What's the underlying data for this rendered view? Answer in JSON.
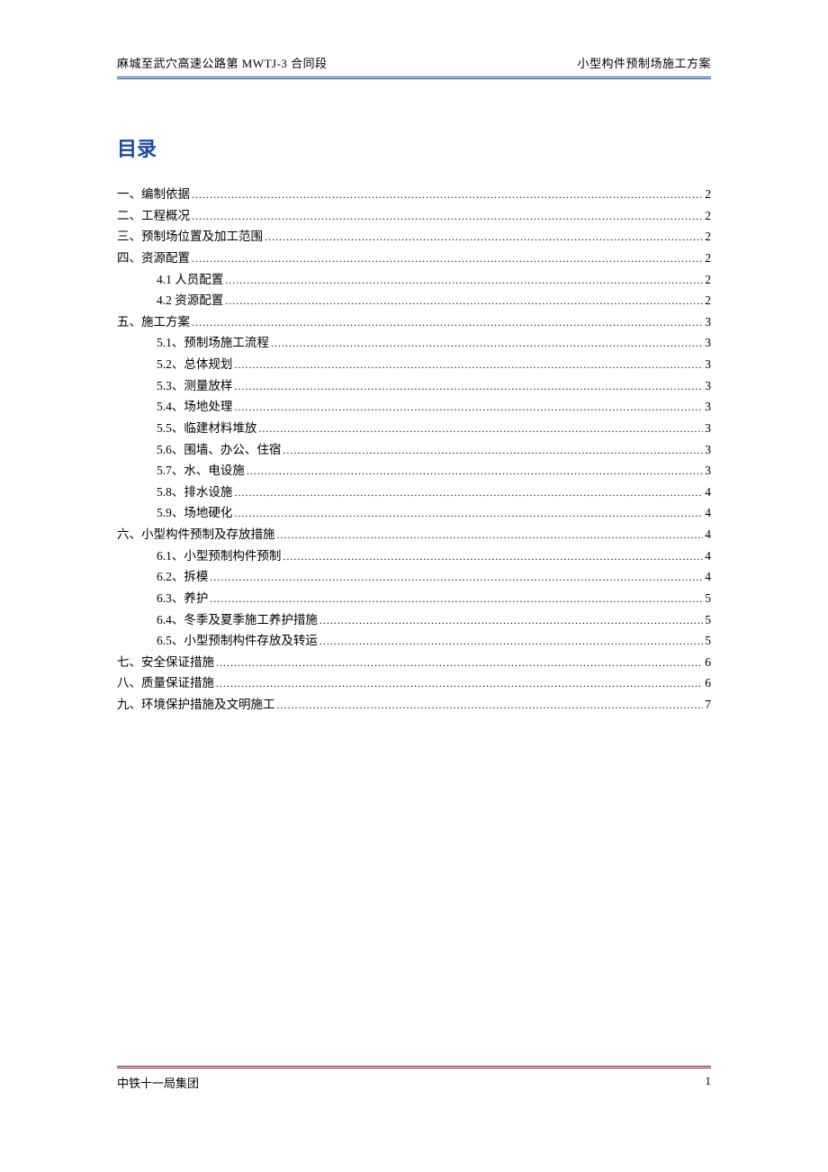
{
  "header": {
    "left": "麻城至武穴高速公路第 MWTJ-3 合同段",
    "right": "小型构件预制场施工方案"
  },
  "toc": {
    "title": "目录",
    "items": [
      {
        "level": 0,
        "label": "一、编制依据",
        "page": "2"
      },
      {
        "level": 0,
        "label": "二、工程概况",
        "page": "2"
      },
      {
        "level": 0,
        "label": "三、预制场位置及加工范围",
        "page": "2"
      },
      {
        "level": 0,
        "label": "四、资源配置",
        "page": "2"
      },
      {
        "level": 1,
        "label": "4.1 人员配置",
        "page": "2"
      },
      {
        "level": 1,
        "label": "4.2 资源配置",
        "page": "2"
      },
      {
        "level": 0,
        "label": "五、施工方案",
        "page": "3"
      },
      {
        "level": 1,
        "label": "5.1、预制场施工流程",
        "page": "3"
      },
      {
        "level": 1,
        "label": "5.2、总体规划",
        "page": "3"
      },
      {
        "level": 1,
        "label": "5.3、测量放样",
        "page": "3"
      },
      {
        "level": 1,
        "label": "5.4、场地处理",
        "page": "3"
      },
      {
        "level": 1,
        "label": "5.5、临建材料堆放",
        "page": "3"
      },
      {
        "level": 1,
        "label": "5.6、围墙、办公、住宿",
        "page": "3"
      },
      {
        "level": 1,
        "label": "5.7、水、电设施",
        "page": "3"
      },
      {
        "level": 1,
        "label": "5.8、排水设施",
        "page": "4"
      },
      {
        "level": 1,
        "label": "5.9、场地硬化",
        "page": "4"
      },
      {
        "level": 0,
        "label": "六、小型构件预制及存放措施",
        "page": "4"
      },
      {
        "level": 1,
        "label": "6.1、小型预制构件预制",
        "page": "4"
      },
      {
        "level": 1,
        "label": "6.2、拆模",
        "page": "4"
      },
      {
        "level": 1,
        "label": "6.3、养护",
        "page": "5"
      },
      {
        "level": 1,
        "label": "6.4、冬季及夏季施工养护措施",
        "page": "5"
      },
      {
        "level": 1,
        "label": "6.5、小型预制构件存放及转运",
        "page": "5"
      },
      {
        "level": 0,
        "label": "七、安全保证措施",
        "page": "6"
      },
      {
        "level": 0,
        "label": "八、质量保证措施",
        "page": "6"
      },
      {
        "level": 0,
        "label": "九、环境保护措施及文明施工",
        "page": "7"
      }
    ]
  },
  "footer": {
    "left": "中铁十一局集团",
    "right": "1"
  }
}
